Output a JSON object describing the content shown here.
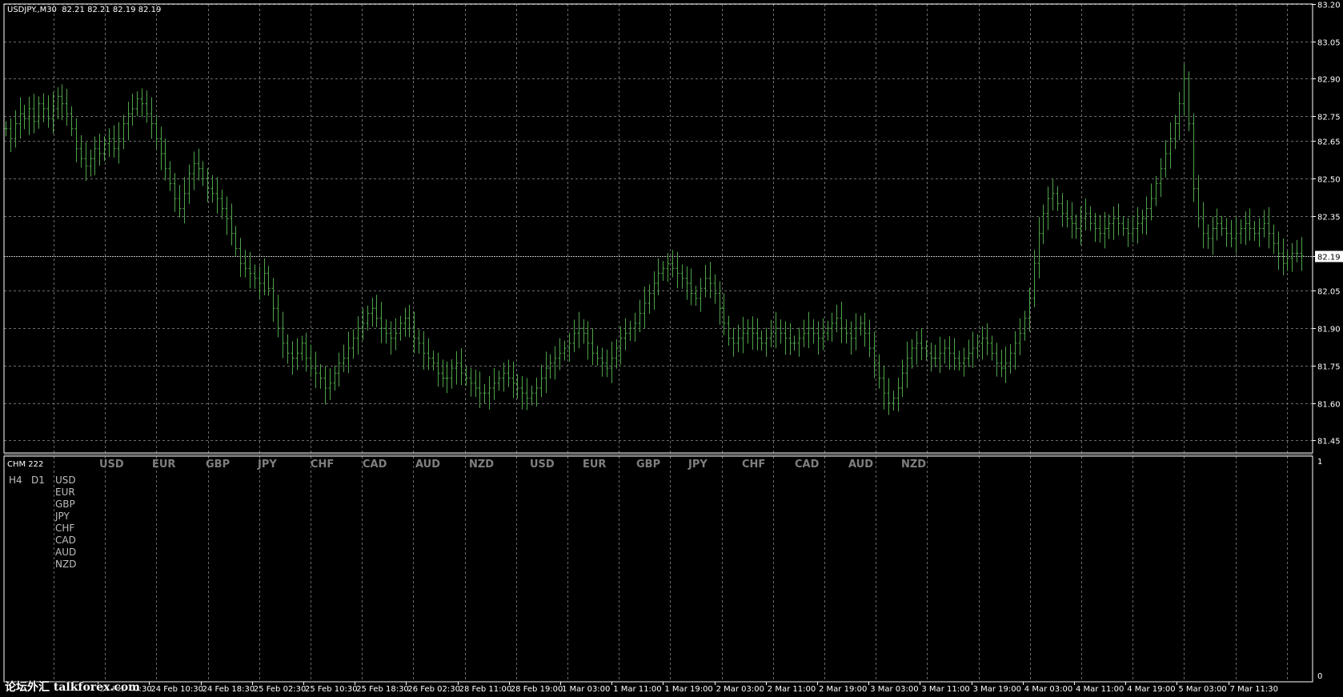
{
  "header": {
    "symbol_info": "USDJPY.,M30",
    "ohlc": "82.21 82.21 82.19 82.19"
  },
  "price_axis": {
    "ticks": [
      "83.20",
      "83.05",
      "82.90",
      "82.75",
      "82.65",
      "82.50",
      "82.35",
      "82.19",
      "82.05",
      "81.90",
      "81.75",
      "81.60",
      "81.45"
    ],
    "current_price": "82.19",
    "current_price_value": 82.19,
    "range": [
      81.4,
      83.2
    ]
  },
  "time_axis": {
    "labels": [
      "24 Feb 02:30",
      "24 Feb 10:30",
      "24 Feb 18:30",
      "25 Feb 02:30",
      "25 Feb 10:30",
      "25 Feb 18:30",
      "26 Feb 02:30",
      "28 Feb 11:00",
      "28 Feb 19:00",
      "1 Mar 03:00",
      "1 Mar 11:00",
      "1 Mar 19:00",
      "2 Mar 03:00",
      "2 Mar 11:00",
      "2 Mar 19:00",
      "3 Mar 03:00",
      "3 Mar 11:00",
      "3 Mar 19:00",
      "4 Mar 03:00",
      "4 Mar 11:00",
      "4 Mar 19:00",
      "5 Mar 03:00",
      "7 Mar 11:30"
    ]
  },
  "indicator": {
    "name": "CHM 222",
    "axis_top": "1",
    "axis_bottom": "0",
    "currencies_top": [
      "USD",
      "EUR",
      "GBP",
      "JPY",
      "CHF",
      "CAD",
      "AUD",
      "NZD",
      "USD",
      "EUR",
      "GBP",
      "JPY",
      "CHF",
      "CAD",
      "AUD",
      "NZD"
    ],
    "timeframes": [
      "H4",
      "D1"
    ],
    "currency_list": [
      "USD",
      "EUR",
      "GBP",
      "JPY",
      "CHF",
      "CAD",
      "AUD",
      "NZD"
    ]
  },
  "watermark": "论坛外汇 talkforex.com",
  "colors": {
    "background": "#000000",
    "grid": "#6b6b6b",
    "bars": "#4fa34a",
    "text": "#ffffff",
    "indicator_text": "#7f7f7f"
  },
  "chart_data": {
    "type": "bar",
    "series": [
      {
        "name": "USDJPY.,M30",
        "values": [
          82.7,
          82.66,
          82.72,
          82.76,
          82.74,
          82.78,
          82.73,
          82.8,
          82.78,
          82.74,
          82.78,
          82.83,
          82.8,
          82.76,
          82.7,
          82.62,
          82.58,
          82.55,
          82.58,
          82.62,
          82.6,
          82.64,
          82.66,
          82.62,
          82.66,
          82.72,
          82.76,
          82.78,
          82.82,
          82.8,
          82.76,
          82.72,
          82.66,
          82.6,
          82.54,
          82.48,
          82.42,
          82.38,
          82.44,
          82.52,
          82.56,
          82.54,
          82.5,
          82.46,
          82.44,
          82.42,
          82.38,
          82.34,
          82.28,
          82.22,
          82.16,
          82.14,
          82.12,
          82.1,
          82.08,
          82.12,
          82.06,
          81.98,
          81.9,
          81.84,
          81.8,
          81.78,
          81.8,
          81.84,
          81.78,
          81.74,
          81.72,
          81.7,
          81.66,
          81.68,
          81.72,
          81.76,
          81.78,
          81.82,
          81.86,
          81.9,
          81.92,
          81.96,
          81.98,
          81.94,
          81.9,
          81.88,
          81.86,
          81.88,
          81.92,
          81.94,
          81.9,
          81.86,
          81.84,
          81.8,
          81.78,
          81.76,
          81.72,
          81.7,
          81.7,
          81.74,
          81.76,
          81.72,
          81.7,
          81.68,
          81.66,
          81.64,
          81.64,
          81.66,
          81.68,
          81.7,
          81.72,
          81.7,
          81.68,
          81.66,
          81.64,
          81.62,
          81.64,
          81.66,
          81.7,
          81.74,
          81.76,
          81.78,
          81.8,
          81.82,
          81.84,
          81.88,
          81.9,
          81.88,
          81.84,
          81.8,
          81.78,
          81.76,
          81.74,
          81.78,
          81.82,
          81.86,
          81.88,
          81.9,
          81.92,
          81.96,
          82.0,
          82.04,
          82.08,
          82.12,
          82.14,
          82.16,
          82.14,
          82.12,
          82.1,
          82.08,
          82.04,
          82.02,
          82.06,
          82.1,
          82.08,
          82.04,
          81.98,
          81.92,
          81.86,
          81.84,
          81.86,
          81.88,
          81.9,
          81.88,
          81.86,
          81.84,
          81.86,
          81.88,
          81.9,
          81.88,
          81.86,
          81.84,
          81.84,
          81.86,
          81.88,
          81.9,
          81.88,
          81.86,
          81.88,
          81.9,
          81.92,
          81.94,
          81.9,
          81.88,
          81.86,
          81.9,
          81.92,
          81.88,
          81.82,
          81.76,
          81.7,
          81.64,
          81.6,
          81.62,
          81.66,
          81.72,
          81.78,
          81.82,
          81.84,
          81.82,
          81.8,
          81.78,
          81.78,
          81.8,
          81.82,
          81.8,
          81.78,
          81.76,
          81.78,
          81.8,
          81.82,
          81.84,
          81.86,
          81.84,
          81.8,
          81.76,
          81.74,
          81.76,
          81.8,
          81.84,
          81.88,
          81.94,
          82.02,
          82.16,
          82.28,
          82.36,
          82.42,
          82.44,
          82.4,
          82.36,
          82.34,
          82.32,
          82.3,
          82.34,
          82.36,
          82.32,
          82.3,
          82.28,
          82.3,
          82.32,
          82.34,
          82.32,
          82.3,
          82.28,
          82.3,
          82.32,
          82.34,
          82.38,
          82.42,
          82.48,
          82.54,
          82.6,
          82.66,
          82.72,
          82.8,
          82.9,
          82.72,
          82.46,
          82.34,
          82.28,
          82.26,
          82.3,
          82.32,
          82.3,
          82.28,
          82.26,
          82.28,
          82.3,
          82.32,
          82.3,
          82.28,
          82.3,
          82.32,
          82.28,
          82.24,
          82.2,
          82.16,
          82.18,
          82.2,
          82.2,
          82.19
        ]
      }
    ],
    "ylim": [
      81.4,
      83.2
    ]
  }
}
